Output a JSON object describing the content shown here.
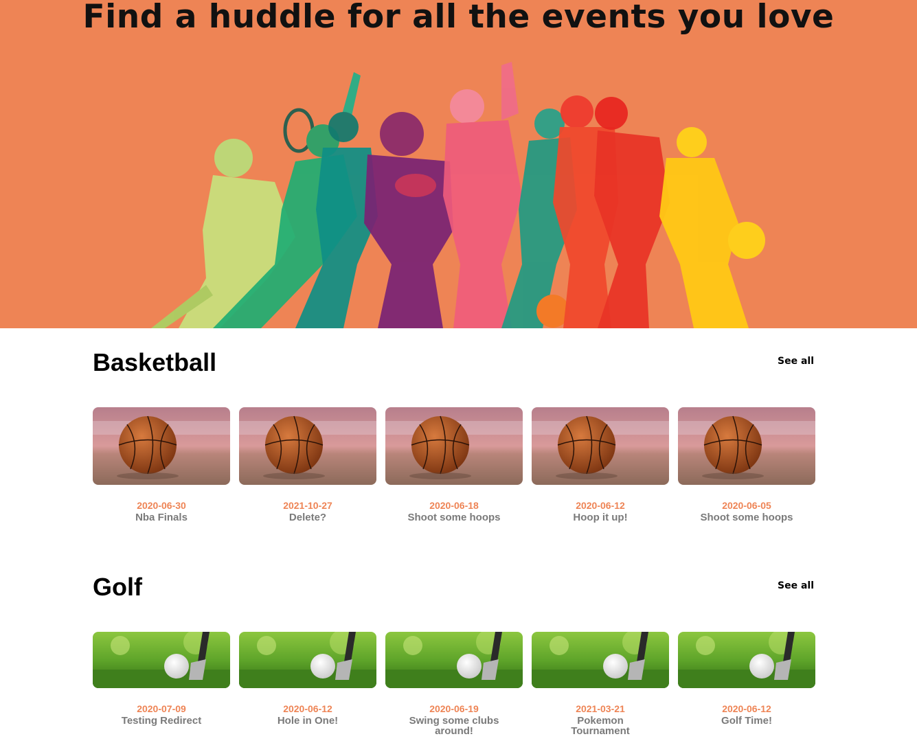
{
  "hero": {
    "title": "Find a huddle for all the events you love",
    "background": "#ee8455"
  },
  "sections": [
    {
      "title": "Basketball",
      "see_all": "See all",
      "image": "basketball-photo",
      "events": [
        {
          "date": "2020-06-30",
          "name": "Nba Finals"
        },
        {
          "date": "2021-10-27",
          "name": "Delete?"
        },
        {
          "date": "2020-06-18",
          "name": "Shoot some hoops"
        },
        {
          "date": "2020-06-12",
          "name": "Hoop it up!"
        },
        {
          "date": "2020-06-05",
          "name": "Shoot some hoops"
        }
      ]
    },
    {
      "title": "Golf",
      "see_all": "See all",
      "image": "golf-photo",
      "events": [
        {
          "date": "2020-07-09",
          "name": "Testing Redirect"
        },
        {
          "date": "2020-06-12",
          "name": "Hole in One!"
        },
        {
          "date": "2020-06-19",
          "name": "Swing some clubs around!"
        },
        {
          "date": "2021-03-21",
          "name": "Pokemon Tournament"
        },
        {
          "date": "2020-06-12",
          "name": "Golf Time!"
        }
      ]
    }
  ],
  "colors": {
    "accent": "#ee8455",
    "event_name": "#7a7a7a"
  }
}
